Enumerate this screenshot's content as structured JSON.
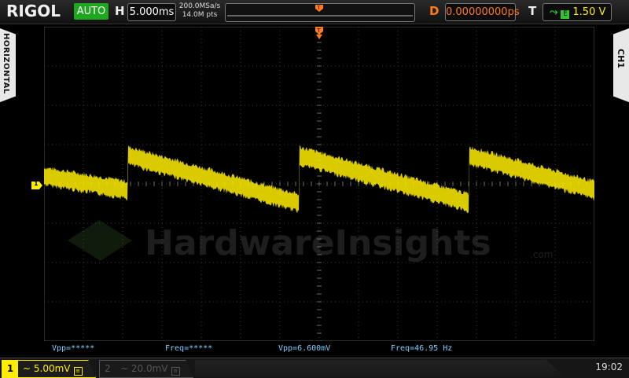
{
  "header": {
    "brand": "RIGOL",
    "mode": "AUTO",
    "h_label": "H",
    "timebase": "5.000ms",
    "sample_rate": "200.0MSa/s",
    "memory_depth": "14.0M pts",
    "d_label": "D",
    "trigger_delay": "0.00000000ps",
    "t_label": "T",
    "trigger_source": "E",
    "trigger_level": "1.50 V"
  },
  "side": {
    "left_tab": "HORIZONTAL",
    "right_tab": "CH1"
  },
  "channel_marker": "1",
  "measurements": [
    {
      "text": "Vpp=*****"
    },
    {
      "text": "Freq=*****"
    },
    {
      "text": "Vpp=6.600mV"
    },
    {
      "text": "Freq=46.95 Hz"
    }
  ],
  "watermark": "HardwareInsights",
  "watermark_suffix": ".com",
  "footer": {
    "ch1_number": "1",
    "ch1_scale": "~ 5.00mV",
    "ch2_number": "2",
    "ch2_scale": "~ 20.0mV",
    "clock": "19:02"
  },
  "colors": {
    "ch1": "#ffee00",
    "trigger": "#ff7a1a",
    "mode_active": "#1fa81f",
    "measure_text": "#7fd0ff"
  }
}
